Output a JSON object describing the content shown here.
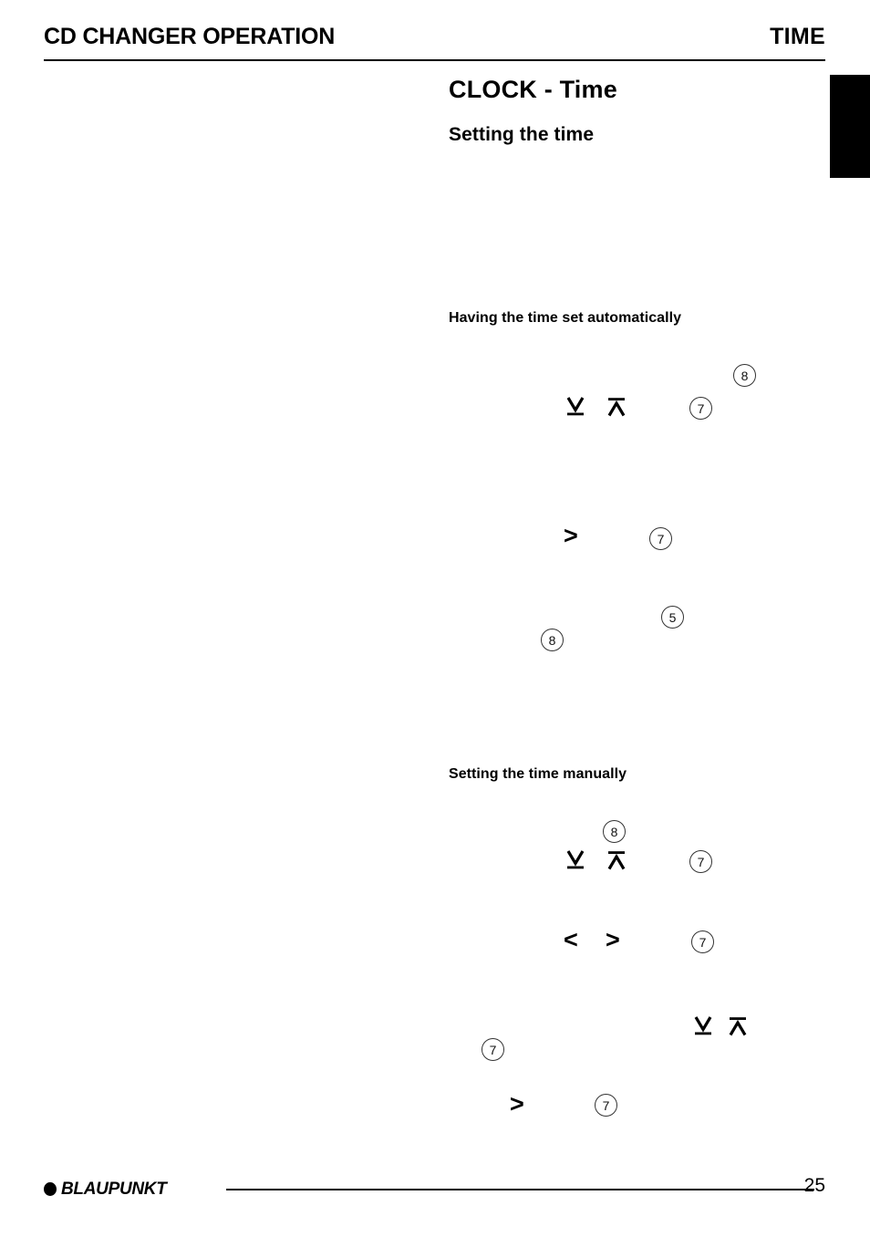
{
  "header": {
    "left_title": "CD CHANGER OPERATION",
    "right_title": "TIME"
  },
  "content": {
    "title": "CLOCK - Time",
    "subtitle": "Setting the time",
    "section_auto": "Having the time set automatically",
    "section_manual": "Setting the time manually"
  },
  "marks": {
    "chevron_right": ">",
    "chevron_left": "<",
    "arrow_down_bar": "down-arrow-with-bar",
    "arrow_up_bar": "up-arrow-with-bar"
  },
  "callouts": {
    "auto_row1_a": "8",
    "auto_row1_b": "7",
    "auto_row2": "7",
    "auto_row3_a": "5",
    "auto_row3_b": "8",
    "manual_row1_top": "8",
    "manual_row1_side": "7",
    "manual_row2": "7",
    "manual_row3": "7",
    "manual_row4": "7"
  },
  "footer": {
    "brand": "BLAUPUNKT",
    "page_number": "25"
  },
  "colors": {
    "ink": "#000000",
    "paper": "#ffffff",
    "callout_outline": "#333333"
  }
}
